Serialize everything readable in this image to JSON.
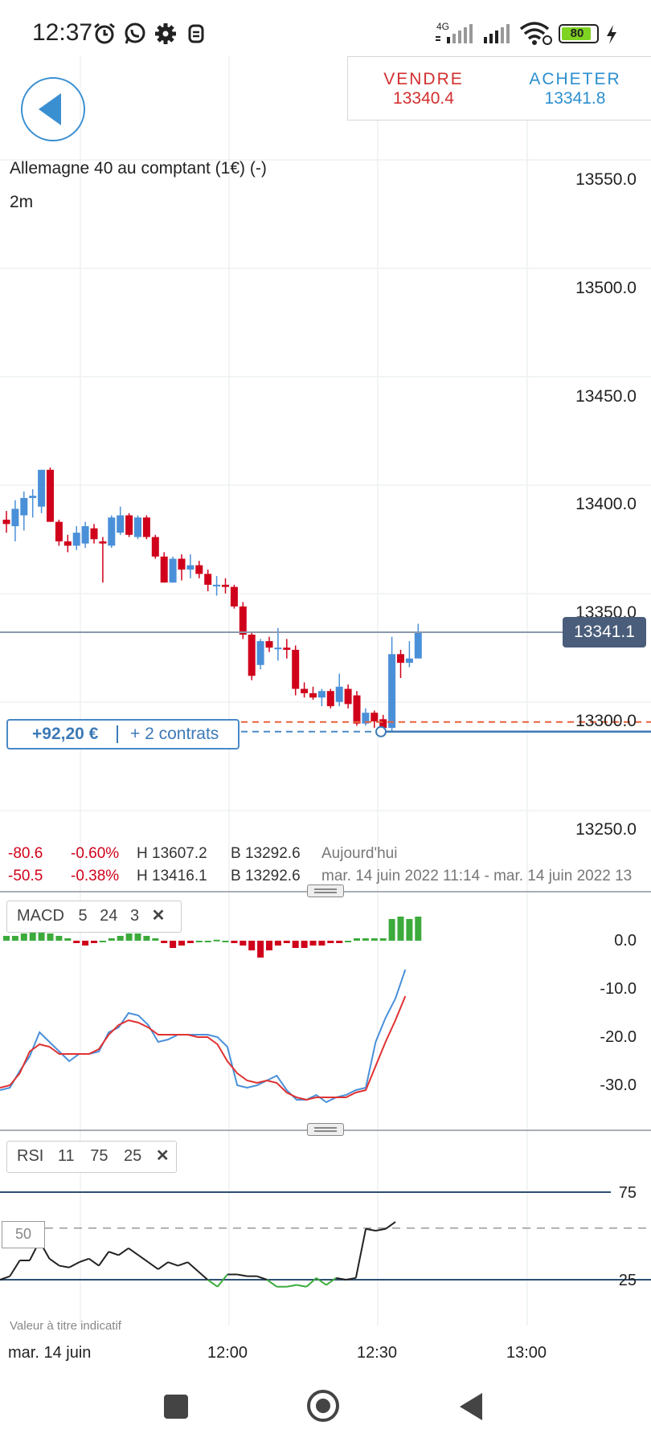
{
  "status_bar": {
    "time": "12:37",
    "network": "4G",
    "battery": "80",
    "icons": [
      "alarm-icon",
      "whatsapp-icon",
      "settings-icon",
      "vpn-icon",
      "signal-icon",
      "signal-icon",
      "wifi-icon",
      "charging-icon"
    ]
  },
  "trade": {
    "sell_label": "VENDRE",
    "sell_price": "13340.4",
    "buy_label": "ACHETER",
    "buy_price": "13341.8",
    "sell_color": "#d32f2f",
    "buy_color": "#2b8fcf"
  },
  "instrument": {
    "name": "Allemagne 40 au comptant (1€) (-)",
    "timeframe": "2m"
  },
  "price_axis": [
    "13550.0",
    "13500.0",
    "13450.0",
    "13400.0",
    "13350.0",
    "13300.0",
    "13250.0"
  ],
  "current_price": "13341.1",
  "position": {
    "pnl": "+92,20 €",
    "contracts": "+ 2 contrats"
  },
  "stats": [
    {
      "change": "-80.6",
      "pct": "-0.60%",
      "high": "H 13607.2",
      "low": "B 13292.6",
      "period": "Aujourd'hui"
    },
    {
      "change": "-50.5",
      "pct": "-0.38%",
      "high": "H 13416.1",
      "low": "B 13292.6",
      "period": "mar. 14 juin 2022 11:14 - mar. 14 juin 2022 13"
    }
  ],
  "macd": {
    "name": "MACD",
    "params": [
      "5",
      "24",
      "3"
    ],
    "axis": [
      "0.0",
      "-10.0",
      "-20.0",
      "-30.0"
    ]
  },
  "rsi": {
    "name": "RSI",
    "params": [
      "11",
      "75",
      "25"
    ],
    "axis": [
      "75",
      "25"
    ],
    "mid": "50"
  },
  "disclaimer": "Valeur à titre indicatif",
  "time_axis": {
    "date": "mar. 14 juin",
    "ticks": [
      "12:00",
      "12:30",
      "13:00"
    ]
  },
  "colors": {
    "up": "#4a90d9",
    "down": "#d0021b",
    "accent": "#3a8fd1"
  },
  "chart_data": [
    {
      "type": "candlestick",
      "title": "Allemagne 40 au comptant (1€) (-)",
      "timeframe": "2m",
      "ylim": [
        13230,
        13600
      ],
      "candles": [
        {
          "o": 13393,
          "h": 13397,
          "l": 13387,
          "c": 13391
        },
        {
          "o": 13390,
          "h": 13402,
          "l": 13383,
          "c": 13398
        },
        {
          "o": 13395,
          "h": 13406,
          "l": 13388,
          "c": 13403
        },
        {
          "o": 13403,
          "h": 13407,
          "l": 13394,
          "c": 13404
        },
        {
          "o": 13399,
          "h": 13416,
          "l": 13396,
          "c": 13416
        },
        {
          "o": 13416,
          "h": 13417,
          "l": 13392,
          "c": 13392
        },
        {
          "o": 13392,
          "h": 13393,
          "l": 13381,
          "c": 13383
        },
        {
          "o": 13383,
          "h": 13386,
          "l": 13378,
          "c": 13381
        },
        {
          "o": 13381,
          "h": 13390,
          "l": 13379,
          "c": 13387
        },
        {
          "o": 13382,
          "h": 13392,
          "l": 13380,
          "c": 13390
        },
        {
          "o": 13389,
          "h": 13391,
          "l": 13382,
          "c": 13384
        },
        {
          "o": 13383,
          "h": 13385,
          "l": 13364,
          "c": 13382
        },
        {
          "o": 13381,
          "h": 13395,
          "l": 13380,
          "c": 13394
        },
        {
          "o": 13387,
          "h": 13399,
          "l": 13386,
          "c": 13395
        },
        {
          "o": 13395,
          "h": 13396,
          "l": 13385,
          "c": 13386
        },
        {
          "o": 13385,
          "h": 13395,
          "l": 13384,
          "c": 13394
        },
        {
          "o": 13394,
          "h": 13395,
          "l": 13384,
          "c": 13385
        },
        {
          "o": 13385,
          "h": 13386,
          "l": 13375,
          "c": 13376
        },
        {
          "o": 13376,
          "h": 13378,
          "l": 13364,
          "c": 13364
        },
        {
          "o": 13364,
          "h": 13376,
          "l": 13364,
          "c": 13375
        },
        {
          "o": 13375,
          "h": 13377,
          "l": 13365,
          "c": 13370
        },
        {
          "o": 13370,
          "h": 13377,
          "l": 13366,
          "c": 13372
        },
        {
          "o": 13372,
          "h": 13374,
          "l": 13366,
          "c": 13368
        },
        {
          "o": 13368,
          "h": 13370,
          "l": 13360,
          "c": 13363
        },
        {
          "o": 13363,
          "h": 13367,
          "l": 13358,
          "c": 13363
        },
        {
          "o": 13363,
          "h": 13366,
          "l": 13359,
          "c": 13362
        },
        {
          "o": 13362,
          "h": 13363,
          "l": 13352,
          "c": 13353
        },
        {
          "o": 13353,
          "h": 13355,
          "l": 13338,
          "c": 13340
        },
        {
          "o": 13340,
          "h": 13341,
          "l": 13319,
          "c": 13321
        },
        {
          "o": 13326,
          "h": 13338,
          "l": 13324,
          "c": 13337
        },
        {
          "o": 13337,
          "h": 13339,
          "l": 13332,
          "c": 13334
        },
        {
          "o": 13334,
          "h": 13343,
          "l": 13328,
          "c": 13334
        },
        {
          "o": 13334,
          "h": 13338,
          "l": 13329,
          "c": 13333
        },
        {
          "o": 13333,
          "h": 13335,
          "l": 13312,
          "c": 13315
        },
        {
          "o": 13315,
          "h": 13318,
          "l": 13311,
          "c": 13313
        },
        {
          "o": 13313,
          "h": 13316,
          "l": 13310,
          "c": 13311
        },
        {
          "o": 13311,
          "h": 13315,
          "l": 13307,
          "c": 13314
        },
        {
          "o": 13314,
          "h": 13315,
          "l": 13306,
          "c": 13307
        },
        {
          "o": 13309,
          "h": 13322,
          "l": 13307,
          "c": 13316
        },
        {
          "o": 13315,
          "h": 13317,
          "l": 13306,
          "c": 13308
        },
        {
          "o": 13312,
          "h": 13314,
          "l": 13298,
          "c": 13299
        },
        {
          "o": 13299,
          "h": 13306,
          "l": 13298,
          "c": 13304
        },
        {
          "o": 13304,
          "h": 13305,
          "l": 13297,
          "c": 13300
        },
        {
          "o": 13301,
          "h": 13303,
          "l": 13295,
          "c": 13297
        },
        {
          "o": 13297,
          "h": 13339,
          "l": 13295,
          "c": 13331
        },
        {
          "o": 13331,
          "h": 13333,
          "l": 13320,
          "c": 13327
        },
        {
          "o": 13327,
          "h": 13337,
          "l": 13325,
          "c": 13329
        },
        {
          "o": 13329,
          "h": 13345,
          "l": 13339,
          "c": 13341
        }
      ],
      "entry_price": 13296,
      "current_price": 13341.1
    },
    {
      "type": "line",
      "title": "MACD",
      "ylim": [
        -37,
        7
      ],
      "histogram": [
        1,
        1,
        1.5,
        2,
        2,
        1.5,
        1,
        0.5,
        -0.5,
        -1,
        -0.5,
        0,
        0.5,
        1,
        1.5,
        1.5,
        1,
        0.5,
        -0.5,
        -1.5,
        -1,
        -0.5,
        0,
        0,
        0.2,
        0,
        -0.5,
        -1,
        -2,
        -3.5,
        -2,
        -1,
        -0.5,
        -1.5,
        -1.5,
        -1,
        -1,
        -0.5,
        -0.5,
        0,
        0.5,
        0.5,
        0.5,
        0.5,
        4.5,
        5,
        4.5,
        5
      ],
      "series": [
        {
          "name": "MACD",
          "color": "#4a90d9",
          "values": [
            -31,
            -30.5,
            -27,
            -24,
            -19,
            -21,
            -23,
            -25,
            -23.5,
            -23.5,
            -23,
            -19,
            -18,
            -15,
            -15.5,
            -17.5,
            -21,
            -20.5,
            -19.5,
            -19.5,
            -19.5,
            -19.5,
            -20,
            -22,
            -30,
            -30.5,
            -30,
            -29,
            -28,
            -31,
            -33,
            -33,
            -32,
            -33.5,
            -32.5,
            -32,
            -31,
            -30.5,
            -21,
            -16,
            -12,
            -6
          ]
        },
        {
          "name": "Signal",
          "color": "#e03131",
          "values": [
            -30.5,
            -30,
            -27.5,
            -23,
            -21.5,
            -22,
            -23.5,
            -23.5,
            -23.5,
            -23.5,
            -22.5,
            -19.5,
            -17.5,
            -16.5,
            -17,
            -18,
            -19.5,
            -19.5,
            -19.5,
            -19.5,
            -20,
            -20,
            -21.5,
            -25,
            -27.5,
            -29,
            -29.5,
            -29,
            -29.5,
            -31.5,
            -32.5,
            -33,
            -32.5,
            -32.5,
            -32.5,
            -32.5,
            -31.5,
            -31,
            -26,
            -21,
            -16.5,
            -11.5
          ]
        }
      ]
    },
    {
      "type": "line",
      "title": "RSI",
      "ylim": [
        12,
        88
      ],
      "series": [
        {
          "name": "RSI",
          "color": "#222222",
          "values": [
            25,
            27,
            36,
            36,
            47,
            37,
            33,
            32,
            35,
            37,
            33,
            41,
            39,
            43,
            39,
            35,
            31,
            35,
            33,
            35,
            30,
            25,
            21,
            28,
            28,
            27,
            27,
            25,
            21,
            21,
            22,
            21,
            26,
            22,
            26,
            25,
            26,
            54,
            53,
            54,
            58
          ]
        }
      ]
    }
  ]
}
